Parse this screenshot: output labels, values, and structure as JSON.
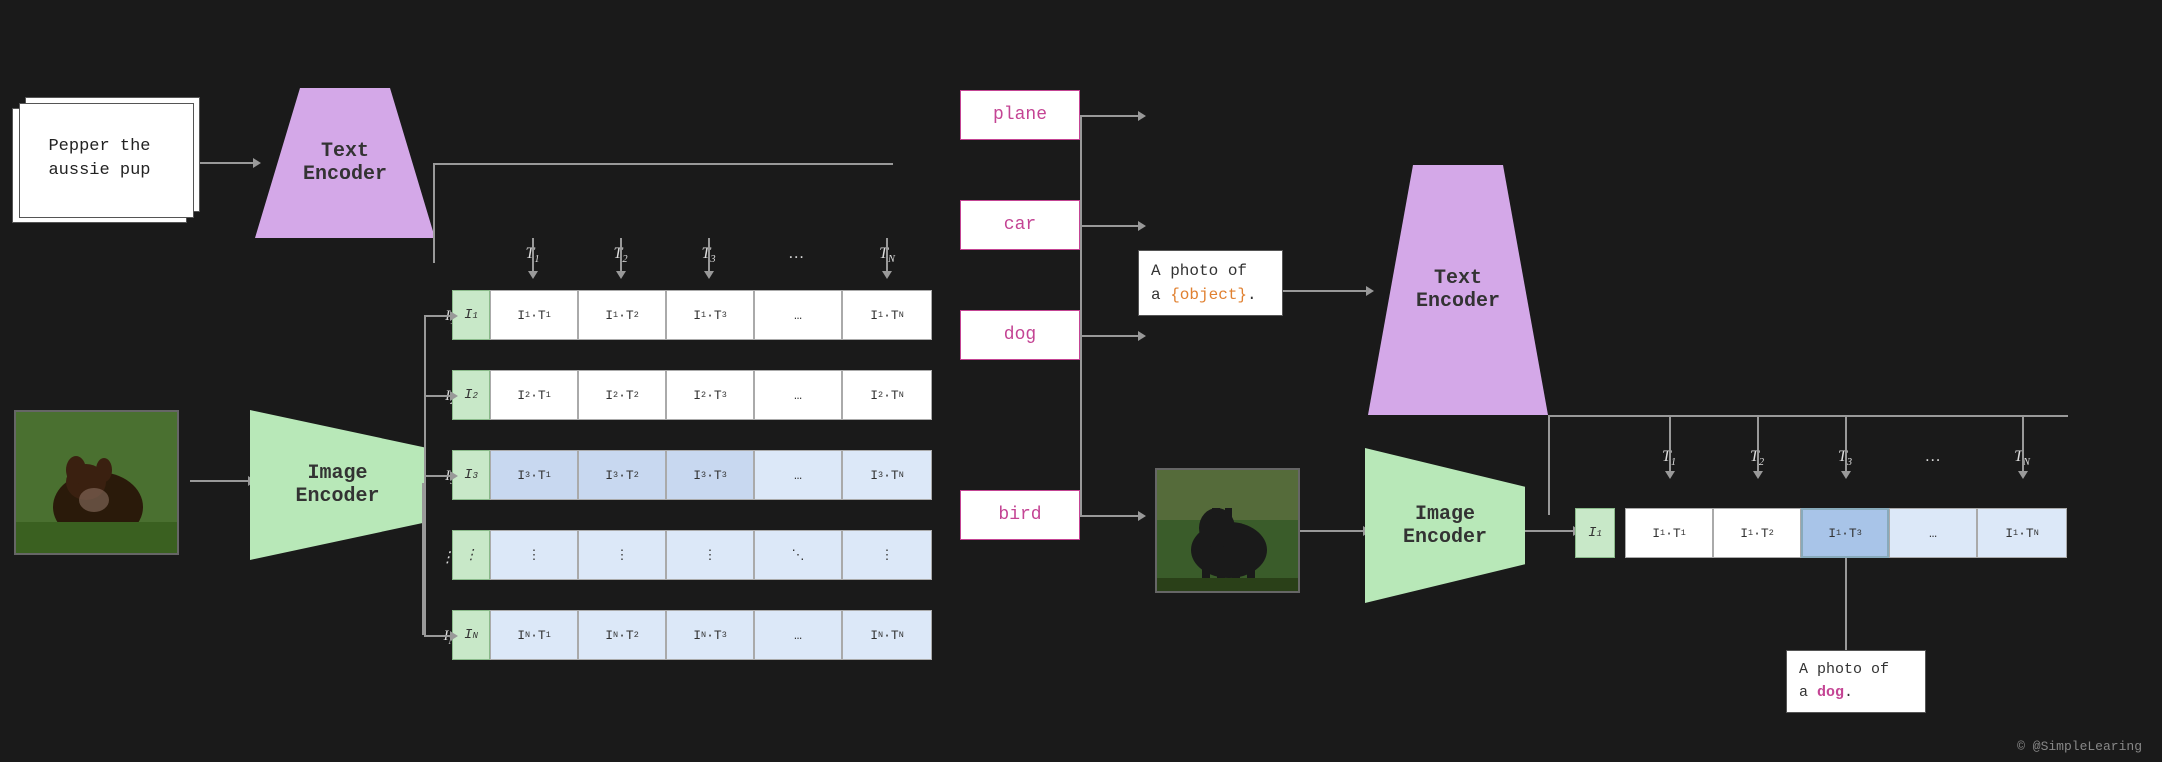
{
  "left_section": {
    "text_input_label": "Pepper the\naussie pup",
    "text_encoder_label": "Text\nEncoder",
    "image_encoder_label": "Image\nEncoder"
  },
  "matrix_left": {
    "col_headers": [
      "T₁",
      "T₂",
      "T₃",
      "…",
      "Tₙ"
    ],
    "row_labels": [
      "I₁",
      "I₂",
      "I₃",
      "⋮",
      "Iₙ"
    ],
    "cells": [
      [
        "I₁·T₁",
        "I₁·T₂",
        "I₁·T₃",
        "…",
        "I₁·Tₙ"
      ],
      [
        "I₂·T₁",
        "I₂·T₂",
        "I₂·T₃",
        "…",
        "I₂·Tₙ"
      ],
      [
        "I₃·T₁",
        "I₃·T₂",
        "I₃·T₃",
        "…",
        "I₃·Tₙ"
      ],
      [
        "⋮",
        "⋮",
        "⋮",
        "⋱",
        "⋮"
      ],
      [
        "Iₙ·T₁",
        "Iₙ·T₂",
        "Iₙ·T₃",
        "…",
        "Iₙ·Tₙ"
      ]
    ]
  },
  "class_labels": [
    "plane",
    "car",
    "dog",
    "bird"
  ],
  "template": {
    "text": "A photo of\na {object}.",
    "object_placeholder": "{object}"
  },
  "right_section": {
    "text_encoder_label": "Text\nEncoder",
    "image_encoder_label": "Image\nEncoder"
  },
  "matrix_right": {
    "col_headers": [
      "T₁",
      "T₂",
      "T₃",
      "…",
      "Tₙ"
    ],
    "row_label": "I₁",
    "cells": [
      "I₁·T₁",
      "I₁·T₂",
      "I₁·T₃",
      "…",
      "I₁·Tₙ"
    ]
  },
  "result_template": {
    "text": "A photo of\na dog."
  },
  "watermark": "© @SimpleLearing"
}
